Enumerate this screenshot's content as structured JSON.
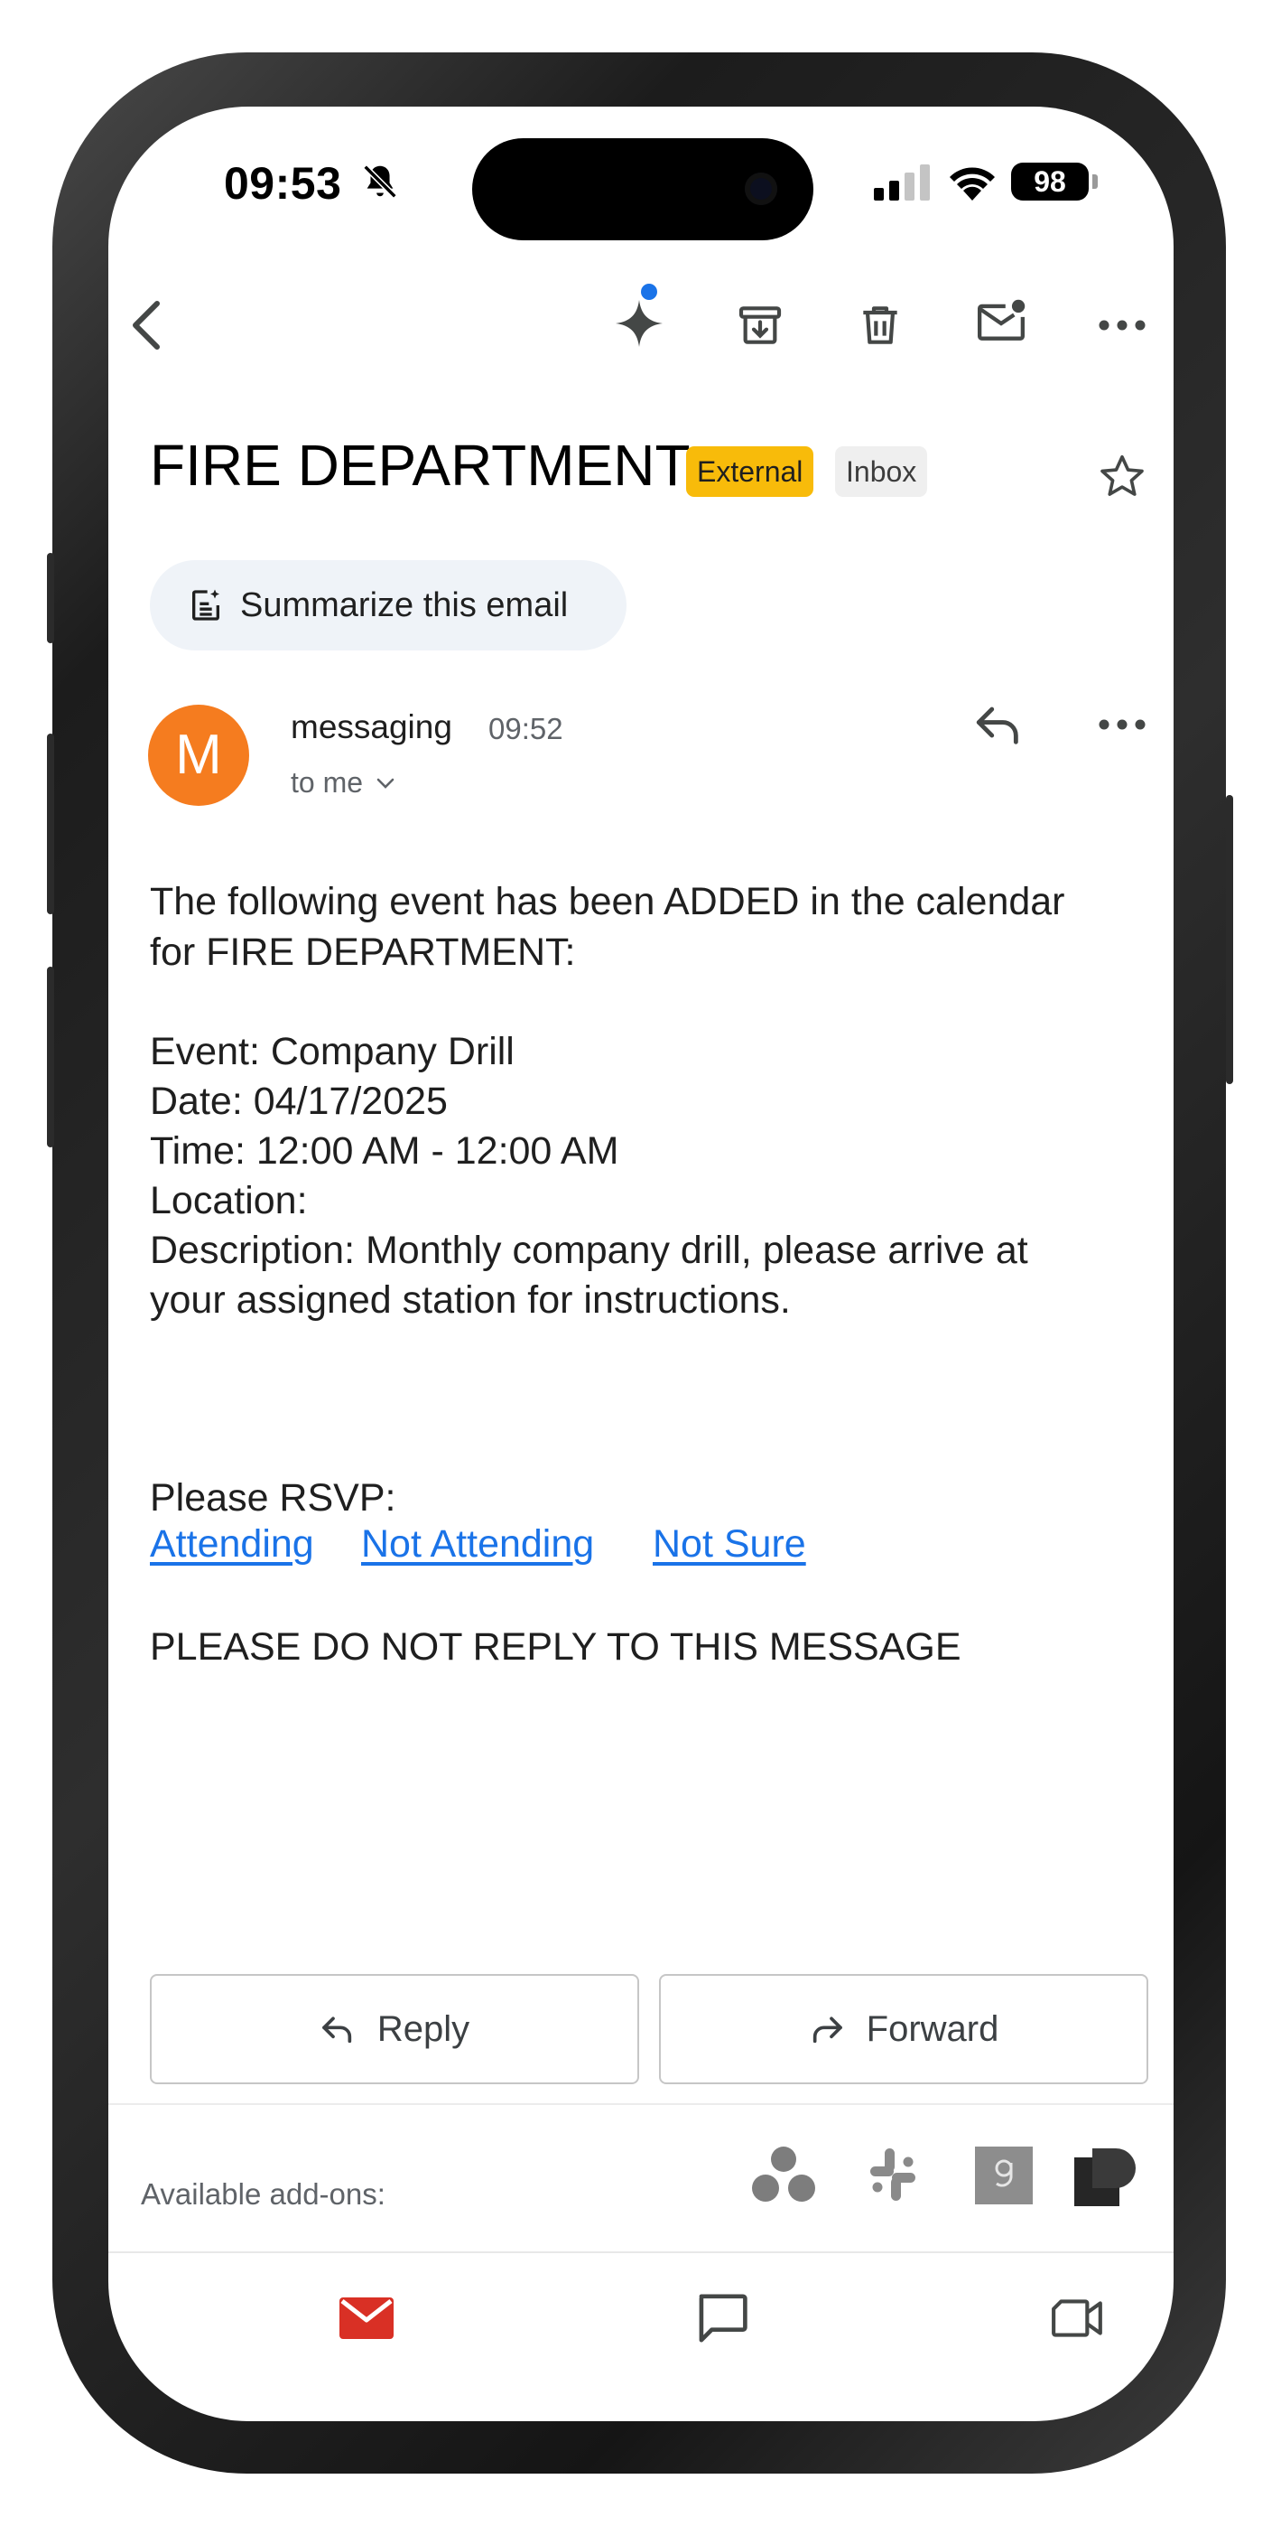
{
  "status_bar": {
    "time": "09:53",
    "battery": "98"
  },
  "email": {
    "subject": "FIRE DEPARTMENT",
    "labels": {
      "external": "External",
      "inbox": "Inbox"
    },
    "summarize_label": "Summarize this email",
    "sender": {
      "initial": "M",
      "name": "messaging",
      "time": "09:52",
      "recipient": "to me"
    },
    "body": {
      "intro_line1": "The following event has been ADDED in the calendar",
      "intro_line2": "for FIRE DEPARTMENT:",
      "event": "Event: Company Drill",
      "date": "Date: 04/17/2025",
      "time": "Time: 12:00 AM - 12:00 AM",
      "location": "Location:",
      "description_line1": "Description: Monthly company drill, please arrive at",
      "description_line2": "your assigned station for instructions.",
      "rsvp_prompt": "Please RSVP:",
      "rsvp_links": [
        "Attending",
        "Not Attending",
        "Not Sure"
      ],
      "footer": "PLEASE DO NOT REPLY TO THIS MESSAGE"
    }
  },
  "actions": {
    "reply": "Reply",
    "forward": "Forward"
  },
  "addons": {
    "label": "Available add-ons:",
    "icons": [
      "circles-addon-icon",
      "slack-addon-icon",
      "g-addon-icon",
      "dark-addon-icon"
    ]
  },
  "bottom_nav": [
    "mail-icon",
    "chat-icon",
    "video-icon"
  ],
  "colors": {
    "external_badge": "#f8bb0a",
    "avatar": "#f57c1f",
    "link": "#1a73e8",
    "mail_active": "#d93025",
    "gemini_dot": "#1a73e8"
  }
}
